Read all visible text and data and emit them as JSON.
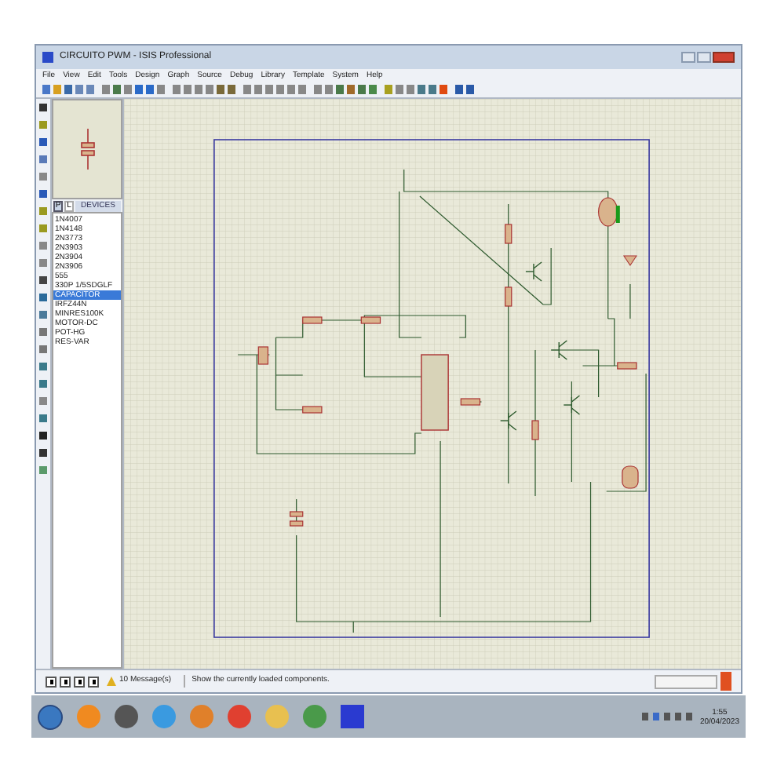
{
  "window": {
    "title": "CIRCUITO PWM - ISIS Professional"
  },
  "menu": [
    "File",
    "View",
    "Edit",
    "Tools",
    "Design",
    "Graph",
    "Source",
    "Debug",
    "Library",
    "Template",
    "System",
    "Help"
  ],
  "device_panel": {
    "tabs": [
      {
        "label": "P",
        "selected": true
      },
      {
        "label": "L",
        "selected": false
      }
    ],
    "title": "DEVICES",
    "devices": [
      {
        "name": "1N4007",
        "selected": false
      },
      {
        "name": "1N4148",
        "selected": false
      },
      {
        "name": "2N3773",
        "selected": false
      },
      {
        "name": "2N3903",
        "selected": false
      },
      {
        "name": "2N3904",
        "selected": false
      },
      {
        "name": "2N3906",
        "selected": false
      },
      {
        "name": "555",
        "selected": false
      },
      {
        "name": "330P 1/5SDGLF",
        "selected": false
      },
      {
        "name": "CAPACITOR",
        "selected": true
      },
      {
        "name": "IRFZ44N",
        "selected": false
      },
      {
        "name": "MINRES100K",
        "selected": false
      },
      {
        "name": "MOTOR-DC",
        "selected": false
      },
      {
        "name": "POT-HG",
        "selected": false
      },
      {
        "name": "RES-VAR",
        "selected": false
      }
    ]
  },
  "status_bar": {
    "messages": "10 Message(s)",
    "hint": "Show the currently loaded components."
  },
  "taskbar": {
    "time": "1:55",
    "date": "20/04/2023"
  }
}
